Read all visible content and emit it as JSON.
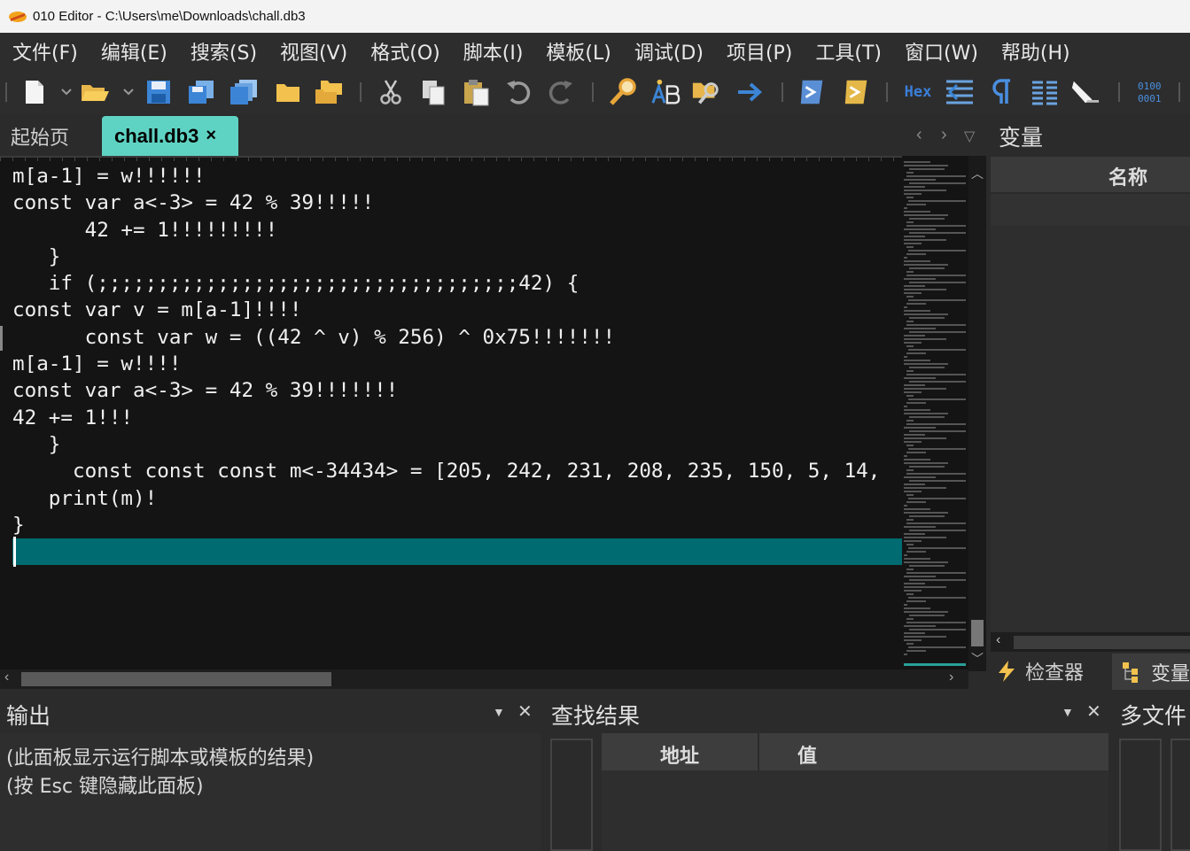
{
  "window": {
    "title": "010 Editor - C:\\Users\\me\\Downloads\\chall.db3"
  },
  "menu": [
    "文件(F)",
    "编辑(E)",
    "搜索(S)",
    "视图(V)",
    "格式(O)",
    "脚本(I)",
    "模板(L)",
    "调试(D)",
    "项目(P)",
    "工具(T)",
    "窗口(W)",
    "帮助(H)"
  ],
  "toolbar": {
    "hex_label": "Hex",
    "binary_label": "0100\n0001"
  },
  "tabs": {
    "start": "起始页",
    "active": "chall.db3",
    "close": "×"
  },
  "editor": {
    "lines": [
      "m[a-1] = w!!!!!!",
      "const var a<-3> = 42 % 39!!!!!",
      "      42 += 1!!!!!!!!!",
      "   }",
      "   if (;;;;;;;;;;;;;;;;;;;;;;;;;;;;;;;;;;;42) {",
      "const var v = m[a-1]!!!!",
      "      const var w = ((42 ^ v) % 256) ^ 0x75!!!!!!!",
      "m[a-1] = w!!!!",
      "const var a<-3> = 42 % 39!!!!!!!",
      "42 += 1!!!",
      "   }",
      "     const const const m<-34434> = [205, 242, 231, 208, 235, 150, 5, 14,",
      "   print(m)!",
      "}"
    ]
  },
  "variables_panel": {
    "title": "变量",
    "column_name": "名称",
    "tab_inspector": "检查器",
    "tab_variables": "变量"
  },
  "output_panel": {
    "title": "输出",
    "line1": "(此面板显示运行脚本或模板的结果)",
    "line2": "(按 Esc 键隐藏此面板)"
  },
  "find_panel": {
    "title": "查找结果",
    "col_address": "地址",
    "col_value": "值"
  },
  "multi_panel": {
    "title": "多文件"
  },
  "colors": {
    "accent_tab": "#5fd3c3",
    "line_highlight": "#006b70",
    "editor_bg": "#141414"
  }
}
